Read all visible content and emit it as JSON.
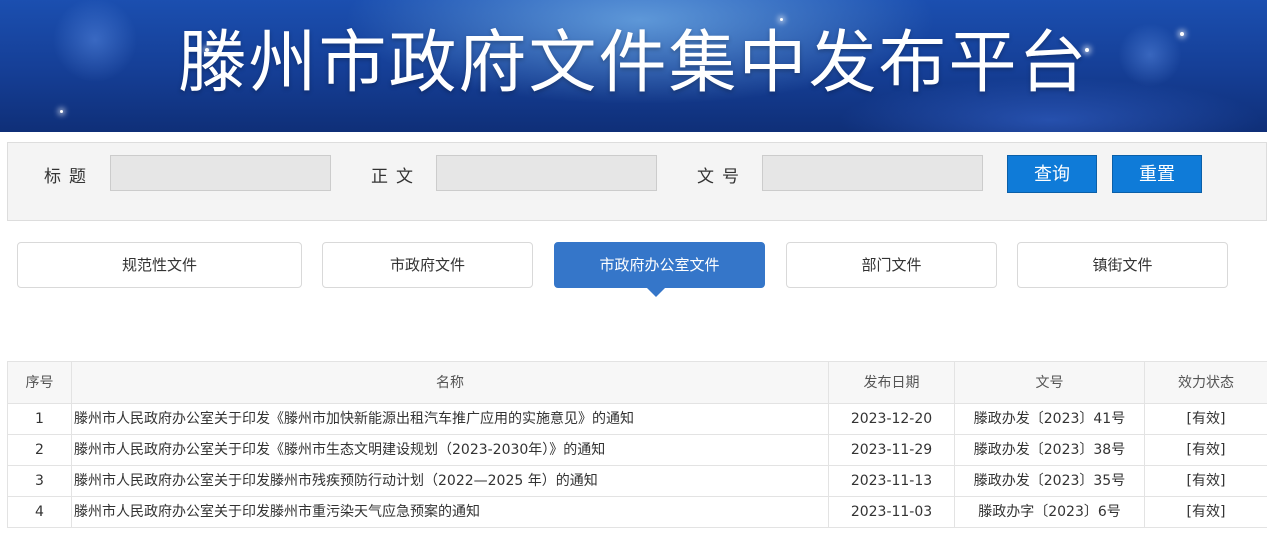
{
  "banner": {
    "title": "滕州市政府文件集中发布平台"
  },
  "search": {
    "fields": [
      {
        "label": "标题",
        "value": ""
      },
      {
        "label": "正文",
        "value": ""
      },
      {
        "label": "文号",
        "value": ""
      }
    ],
    "query_button": "查询",
    "reset_button": "重置"
  },
  "tabs": [
    {
      "label": "规范性文件",
      "active": false
    },
    {
      "label": "市政府文件",
      "active": false
    },
    {
      "label": "市政府办公室文件",
      "active": true
    },
    {
      "label": "部门文件",
      "active": false
    },
    {
      "label": "镇街文件",
      "active": false
    }
  ],
  "table": {
    "headers": [
      "序号",
      "名称",
      "发布日期",
      "文号",
      "效力状态"
    ],
    "rows": [
      {
        "no": "1",
        "name": "滕州市人民政府办公室关于印发《滕州市加快新能源出租汽车推广应用的实施意见》的通知",
        "date": "2023-12-20",
        "doc_no": "滕政办发〔2023〕41号",
        "status": "[有效]"
      },
      {
        "no": "2",
        "name": "滕州市人民政府办公室关于印发《滕州市生态文明建设规划（2023-2030年）》的通知",
        "date": "2023-11-29",
        "doc_no": "滕政办发〔2023〕38号",
        "status": "[有效]"
      },
      {
        "no": "3",
        "name": "滕州市人民政府办公室关于印发滕州市残疾预防行动计划（2022—2025 年）的通知",
        "date": "2023-11-13",
        "doc_no": "滕政办发〔2023〕35号",
        "status": "[有效]"
      },
      {
        "no": "4",
        "name": "滕州市人民政府办公室关于印发滕州市重污染天气应急预案的通知",
        "date": "2023-11-03",
        "doc_no": "滕政办字〔2023〕6号",
        "status": "[有效]"
      }
    ]
  }
}
